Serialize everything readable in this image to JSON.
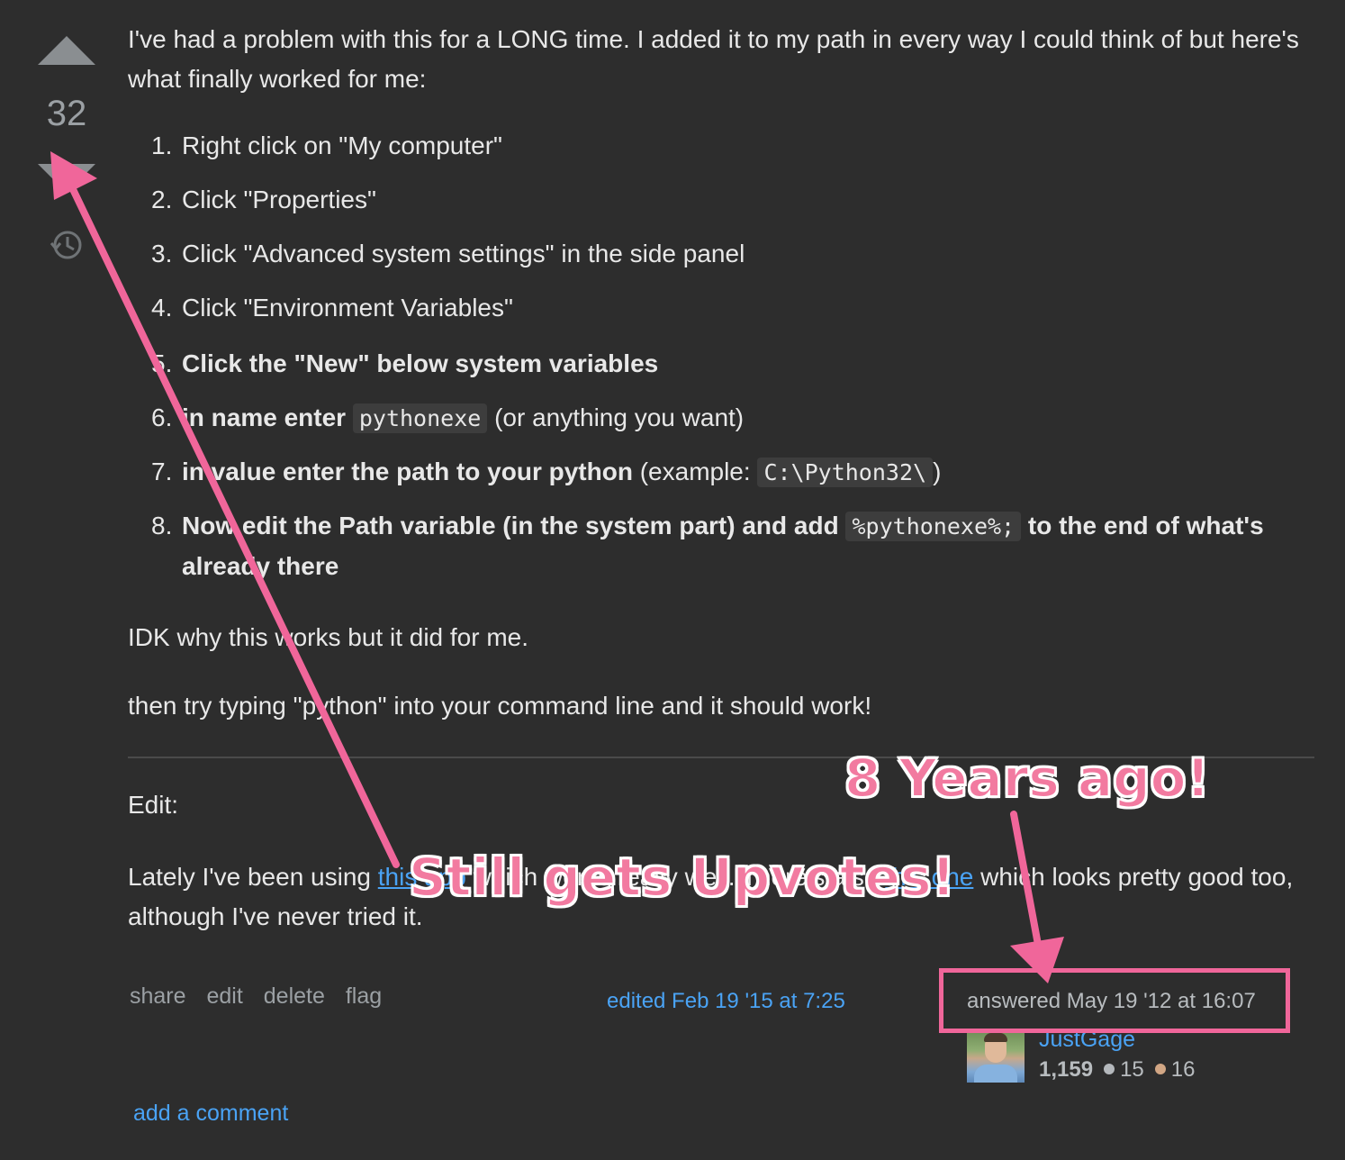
{
  "vote": {
    "count": "32"
  },
  "post": {
    "intro": "I've had a problem with this for a LONG time. I added it to my path in every way I could think of but here's what finally worked for me:",
    "steps": [
      {
        "num": "1.",
        "text": "Right click on \"My computer\""
      },
      {
        "num": "2.",
        "text": "Click \"Properties\""
      },
      {
        "num": "3.",
        "text": "Click \"Advanced system settings\" in the side panel"
      },
      {
        "num": "4.",
        "text": "Click \"Environment Variables\""
      },
      {
        "num": "5.",
        "text": "Click the \"New\" below system variables"
      },
      {
        "num": "6.",
        "bold": "in name enter",
        "code": "pythonexe",
        "rest": "(or anything you want)"
      },
      {
        "num": "7.",
        "bold": "in value enter the path to your python",
        "rest_pre": "(example:",
        "code": "C:\\Python32\\",
        "rest_post": ")"
      },
      {
        "num": "8.",
        "bold": "Now edit the Path variable (in the system part) and add",
        "code": "%pythonexe%;",
        "bold_post": "to the end of what's already there"
      }
    ],
    "idk": "IDK why this works but it did for me.",
    "then": "then try typing \"python\" into your command line and it should work!",
    "edit_label": "Edit:",
    "lately_pre": "Lately I've been using",
    "lately_link1": "this app",
    "lately_mid": "which works really well. There's also",
    "lately_link2": "this one",
    "lately_post": "which looks pretty good too, although I've never tried it."
  },
  "menu": {
    "share": "share",
    "edit": "edit",
    "delete": "delete",
    "flag": "flag"
  },
  "edited": "edited Feb 19 '15 at 7:25",
  "answered": "answered May 19 '12 at 16:07",
  "user": {
    "name": "JustGage",
    "reputation": "1,159",
    "silver": "15",
    "bronze": "16"
  },
  "add_comment": "add a comment",
  "annotations": {
    "years": "8 Years ago!",
    "upvotes": "Still gets Upvotes!",
    "color": "#f0669a"
  }
}
